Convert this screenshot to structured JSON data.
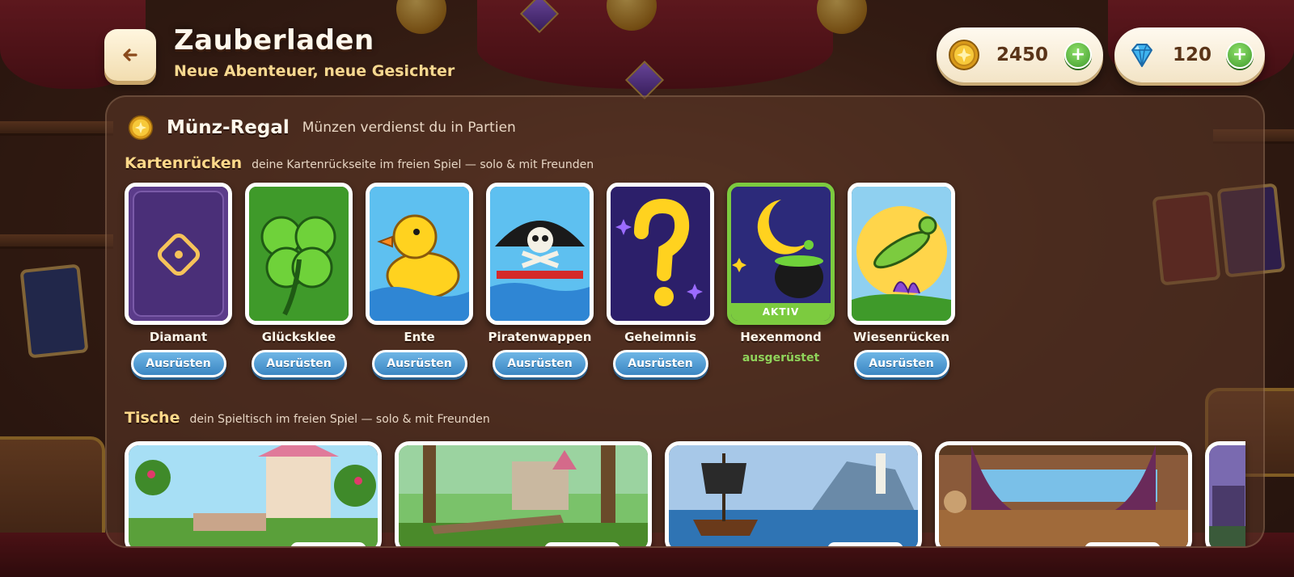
{
  "header": {
    "title": "Zauberladen",
    "subtitle": "Neue Abenteuer, neue Gesichter",
    "back_icon": "arrow-left-icon"
  },
  "currencies": {
    "coins": {
      "icon": "gold-coin-icon",
      "amount": "2450",
      "add_icon": "plus-icon"
    },
    "gems": {
      "icon": "diamond-icon",
      "amount": "120",
      "add_icon": "plus-icon"
    }
  },
  "shelf": {
    "icon": "gold-coin-icon",
    "title": "Münz-Regal",
    "subtitle": "Münzen verdienst du in Partien"
  },
  "card_backs": {
    "title": "Kartenrücken",
    "subtitle": "deine Kartenrückseite im freien Spiel — solo & mit Freunden",
    "button_label": "Ausrüsten",
    "equipped_label": "ausgerüstet",
    "active_tag": "AKTIV",
    "items": [
      {
        "name": "Diamant",
        "icon": "diamond-emblem-icon",
        "active": false
      },
      {
        "name": "Glücksklee",
        "icon": "clover-icon",
        "active": false
      },
      {
        "name": "Ente",
        "icon": "duck-icon",
        "active": false
      },
      {
        "name": "Piratenwappen",
        "icon": "pirate-skull-icon",
        "active": false
      },
      {
        "name": "Geheimnis",
        "icon": "question-mark-icon",
        "active": false
      },
      {
        "name": "Hexenmond",
        "icon": "moon-cauldron-icon",
        "active": true
      },
      {
        "name": "Wiesenrücken",
        "icon": "grasshopper-icon",
        "active": false
      }
    ]
  },
  "tables": {
    "title": "Tische",
    "subtitle": "dein Spieltisch im freien Spiel — solo & mit Freunden",
    "items": [
      {
        "scene": "rose-castle-garden"
      },
      {
        "scene": "forest-ruins"
      },
      {
        "scene": "pirate-ship-coast"
      },
      {
        "scene": "ship-deck-cabin"
      },
      {
        "scene": "haunted-village"
      }
    ]
  },
  "colors": {
    "accent_gold": "#ffd98a",
    "button_blue": "#3b86c2",
    "active_green": "#7ccb3f",
    "text_cream": "#fff8ec"
  }
}
